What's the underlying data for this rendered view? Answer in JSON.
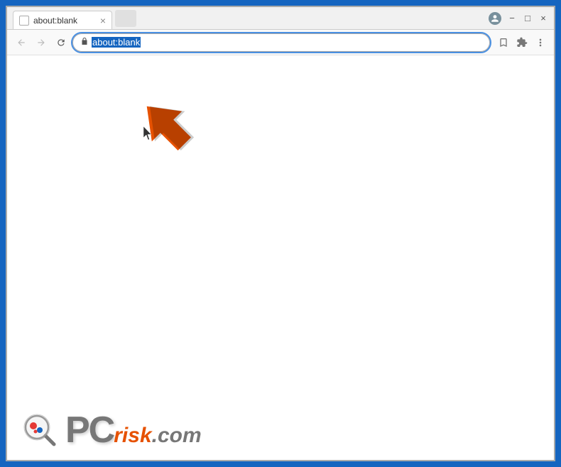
{
  "window": {
    "title": "about:blank",
    "tab_label": "about:blank",
    "tab_close": "×"
  },
  "nav": {
    "back_label": "←",
    "forward_label": "→",
    "reload_label": "↻",
    "address": "about:blank",
    "address_selected": "about:blank"
  },
  "toolbar": {
    "bookmark_icon": "☆",
    "extension_icon": "🧩",
    "menu_icon": "⋮",
    "profile_icon": "👤"
  },
  "window_controls": {
    "minimize": "−",
    "maximize": "□",
    "close": "×"
  },
  "watermark": {
    "pc_letters": "PC",
    "risk": "risk",
    "dot_com": ".com"
  }
}
